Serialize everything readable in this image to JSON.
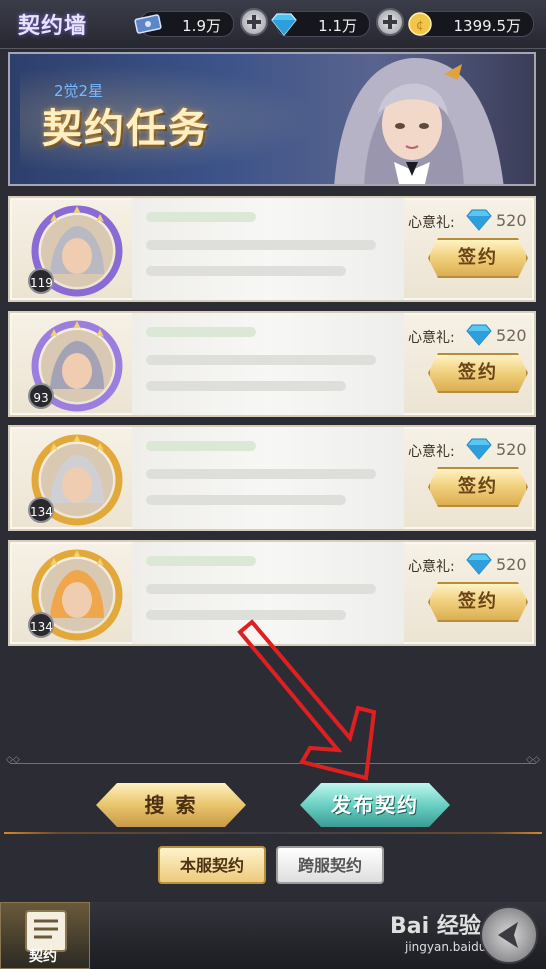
{
  "header": {
    "title": "契约墙",
    "resources": [
      {
        "name": "ticket",
        "icon": "ticket-icon",
        "value": "1.9万"
      },
      {
        "name": "diamond",
        "icon": "diamond-icon",
        "value": "1.1万"
      },
      {
        "name": "gold",
        "icon": "gold-coin-icon",
        "value": "1399.5万"
      }
    ]
  },
  "banner": {
    "subtitle": "2觉2星",
    "title": "契约任务"
  },
  "cards": [
    {
      "level": "119",
      "gift_label": "心意礼:",
      "gift_value": "520",
      "button": "签约",
      "ring_color": "#8a6bd6"
    },
    {
      "level": "93",
      "gift_label": "心意礼:",
      "gift_value": "520",
      "button": "签约",
      "ring_color": "#9c7de0"
    },
    {
      "level": "134",
      "gift_label": "心意礼:",
      "gift_value": "520",
      "button": "签约",
      "ring_color": "#e2a93a"
    },
    {
      "level": "134",
      "gift_label": "心意礼:",
      "gift_value": "520",
      "button": "签约",
      "ring_color": "#e2a93a"
    }
  ],
  "actions": {
    "search": "搜 索",
    "publish": "发布契约"
  },
  "tabs": {
    "local": "本服契约",
    "cross": "跨服契约"
  },
  "nav": {
    "contract": "契约"
  },
  "watermark": {
    "main": "Bai 经验",
    "sub": "jingyan.baidu.com"
  },
  "colors": {
    "annotation_arrow": "#e02020",
    "gold_button": "#f0cf7b",
    "teal_button": "#6ad0c3"
  }
}
